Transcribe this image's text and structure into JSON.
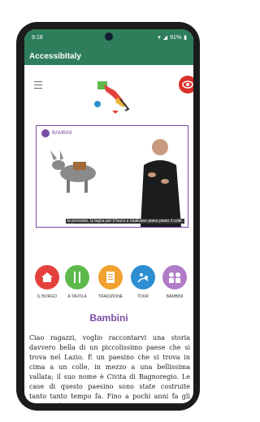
{
  "status": {
    "time": "9:18",
    "battery": "91%"
  },
  "appbar": {
    "title": "AccessibItaly"
  },
  "video": {
    "title": "BAMBINI",
    "subtitle": "le provviste, la legna per il fuoco e risalivano piano piano il colle."
  },
  "categories": [
    {
      "label": "IL BORGO",
      "color": "#e4413e",
      "icon": "home-icon"
    },
    {
      "label": "A TAVOLA",
      "color": "#5db94c",
      "icon": "fork-knife-icon"
    },
    {
      "label": "TRADIZIONE",
      "color": "#f0a12f",
      "icon": "scroll-icon"
    },
    {
      "label": "TOUR",
      "color": "#2d8fd1",
      "icon": "map-icon"
    },
    {
      "label": "BAMBINI",
      "color": "#b07cc7",
      "icon": "children-icon"
    }
  ],
  "section": {
    "title": "Bambini",
    "text": "Ciao ragazzi, voglio raccontarvi una storia davvero bella di un piccolissimo paese che si trova nel Lazio. È un paesino che si trova in cima a un colle, in mezzo a una bellissima vallata; il suo nome è Civita di Bagnoregio. Le case di questo paesino sono state costruite tanto tanto tempo fa. Fino a pochi anni fa gli abitanti di Civita per"
  },
  "colors": {
    "brand": "#2e7d5b",
    "accent": "#7a4ea3",
    "danger": "#d9302a"
  }
}
